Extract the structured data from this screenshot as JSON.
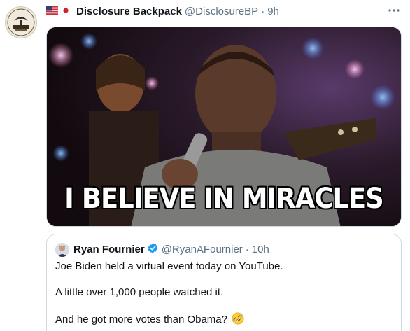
{
  "tweet": {
    "author_name": "Disclosure Backpack",
    "handle": "@DisclosureBP",
    "separator": "·",
    "time": "9h",
    "flags": [
      "us-flag-icon",
      "japan-flag-icon"
    ],
    "avatar_text_top": "BOTTOM OF THE",
    "avatar_text_bottom": "KARATE"
  },
  "media": {
    "caption": "I BELIEVE IN MIRACLES"
  },
  "quoted_tweet": {
    "author_name": "Ryan Fournier",
    "handle": "@RyanAFournier",
    "separator": "·",
    "time": "10h",
    "lines": [
      "Joe Biden held a virtual event today on YouTube.",
      "A little over 1,000 people watched it.",
      "And he got more votes than Obama?"
    ],
    "emoji": "rolling-on-floor-laughing-icon"
  },
  "colors": {
    "text": "#0f1419",
    "secondary": "#5b7083",
    "verified": "#1d9bf0",
    "border": "#cfd9de"
  }
}
